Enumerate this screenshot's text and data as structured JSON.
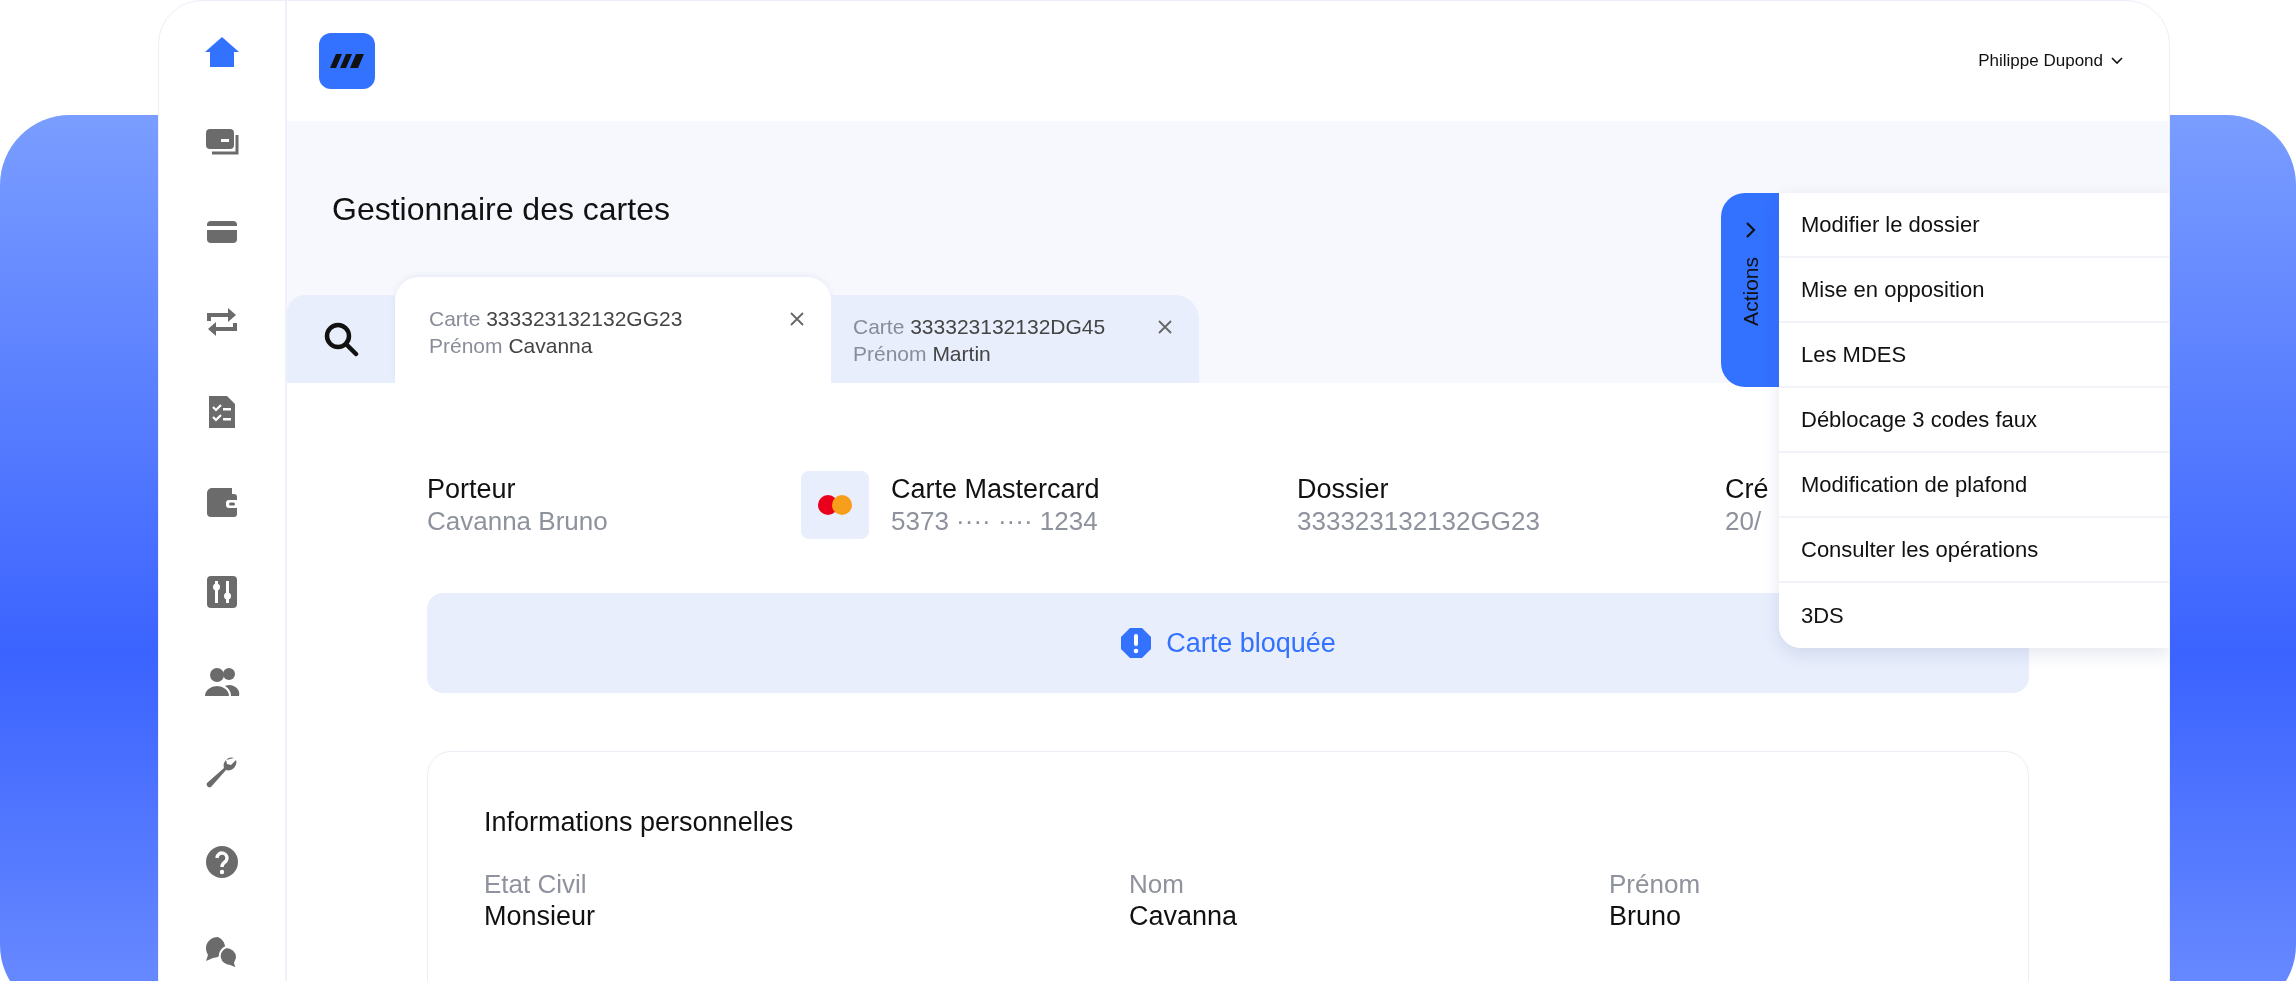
{
  "header": {
    "user_name": "Philippe Dupond"
  },
  "sidebar": {
    "items": [
      {
        "selected": true
      },
      {
        "selected": false
      },
      {
        "selected": false
      },
      {
        "selected": false
      },
      {
        "selected": false
      },
      {
        "selected": false
      },
      {
        "selected": false
      },
      {
        "selected": false
      },
      {
        "selected": false
      },
      {
        "selected": false
      },
      {
        "selected": false
      }
    ]
  },
  "page_title": "Gestionnaire des cartes",
  "tabs": [
    {
      "card_label": "Carte",
      "card_number": "333323132132GG23",
      "name_label": "Prénom",
      "name_value": "Cavanna",
      "selected": true
    },
    {
      "card_label": "Carte",
      "card_number": "333323132132DG45",
      "name_label": "Prénom",
      "name_value": "Martin",
      "selected": false
    }
  ],
  "summary": [
    {
      "kind": "text",
      "label": "Porteur",
      "value": "Cavanna Bruno"
    },
    {
      "kind": "card",
      "label": "Carte Mastercard",
      "value": "5373 ···· ···· 1234"
    },
    {
      "kind": "text",
      "label": "Dossier",
      "value": "333323132132GG23"
    },
    {
      "kind": "text",
      "label": "Cré",
      "value": "20/"
    }
  ],
  "alert": {
    "text": "Carte bloquée"
  },
  "personal_info": {
    "title": "Informations personnelles",
    "fields": [
      {
        "label": "Etat Civil",
        "value": "Monsieur"
      },
      {
        "label": "Nom",
        "value": "Cavanna"
      },
      {
        "label": "Prénom",
        "value": "Bruno"
      }
    ]
  },
  "actions": {
    "label": "Actions",
    "items": [
      "Modifier le dossier",
      "Mise en opposition",
      "Les MDES",
      "Déblocage 3 codes faux",
      "Modification de plafond",
      "Consulter les opérations",
      "3DS"
    ]
  }
}
